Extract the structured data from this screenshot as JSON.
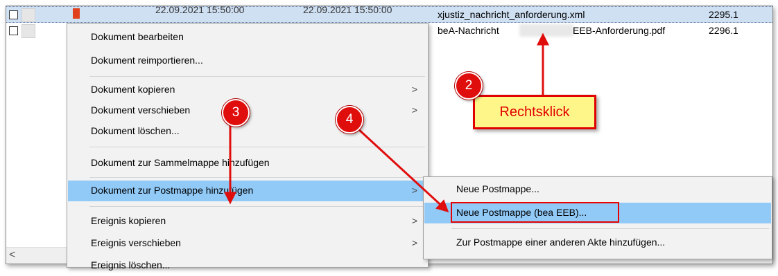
{
  "rows": [
    {
      "date1": "22.09.2021 15:50:00",
      "date2": "22.09.2021 15:50:00",
      "filename": "xjustiz_nachricht_anforderung.xml",
      "number": "2295.1"
    },
    {
      "filename_prefix": "beA-Nachricht",
      "filename_suffix": "EEB-Anforderung.pdf",
      "number": "2296.1"
    }
  ],
  "scroll_left_arrow": "<",
  "context_menu": {
    "items": [
      {
        "label": "Dokument bearbeiten"
      },
      {
        "label": "Dokument reimportieren..."
      },
      {
        "label": "Dokument kopieren",
        "arrow": ">"
      },
      {
        "label": "Dokument verschieben",
        "arrow": ">"
      },
      {
        "label": "Dokument löschen..."
      },
      {
        "label": "Dokument zur Sammelmappe hinzufügen"
      },
      {
        "label": "Dokument zur Postmappe hinzufügen",
        "arrow": ">"
      },
      {
        "label": "Ereignis kopieren",
        "arrow": ">"
      },
      {
        "label": "Ereignis verschieben",
        "arrow": ">"
      },
      {
        "label": "Ereignis löschen..."
      }
    ]
  },
  "submenu": {
    "items": [
      {
        "label": "Neue Postmappe..."
      },
      {
        "label": "Neue Postmappe (bea EEB)..."
      },
      {
        "label": "Zur Postmappe einer anderen Akte hinzufügen..."
      }
    ]
  },
  "annotations": {
    "callout_text": "Rechtsklick",
    "badge_2": "2",
    "badge_3": "3",
    "badge_4": "4",
    "accent_color": "#e00d0d",
    "highlight_color": "#91c9f7",
    "callout_bg": "#fff68a"
  }
}
